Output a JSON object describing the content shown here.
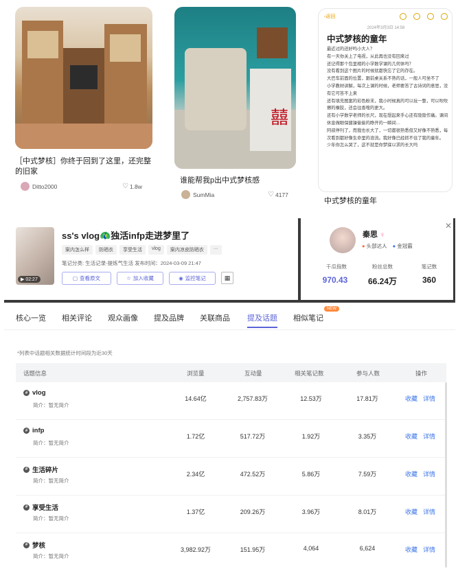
{
  "feed": {
    "card1": {
      "title": "［中式梦核］你终于回到了这里，还完整的旧家",
      "author": "Ditto2000",
      "likes": "1.8w"
    },
    "card2": {
      "title": "谁能帮我p出中式梦核感",
      "author": "SumMia",
      "likes": "4177"
    },
    "card3": {
      "caption": "中式梦核的童年",
      "note": {
        "back_label": "返回",
        "date": "2024年3月3日 14:58",
        "title": "中式梦核的童年",
        "body": "最近过的还好吗小大人？\n有一天你关上了电视，从此再也没有回来过\n还记得那个包里相的小学数学课的几何体吗？\n没有看到这个图片的时候就都快忘了它的存在。\n大巴车前面的位置，跟前桌关系不熟的话，一般人可坐不了\n小学教材讲解，每次上课的时候，老师要答了古诗词的意思，没有它可答不上来\n还有填充图案的彩色粉末，我小时候真的可以玩一整，可以吹吹擦的橡胶，还会往香嗖的更大。\n还有小学数学老师的长尺，现在想起来手心还有隐隐作痛。课间休息做眼保健操偷偷的睁开的一瞬间…\n阿叔停刊了，而我也长大了，一切都很熟悉但又好像不熟悉，每次看到都好像生命里的浪流。我好像已经抓不住了我的童年。\n少年你怎么哭了，这不就是你梦寐以求的长大吗"
      }
    }
  },
  "note_detail": {
    "duration": "02:27",
    "title": "ss's vlog🦚独活infp走进梦里了",
    "tags": [
      "案内怎么样",
      "防晒衣",
      "享受生活",
      "vlog",
      "案内凉皮防晒衣",
      "···"
    ],
    "meta": "笔记分类: 生活记录-提炼气生活  发布时间：2024-03-09 21:47",
    "buttons": {
      "view": "查看原文",
      "collect": "加入收藏",
      "monitor": "监控笔记"
    }
  },
  "profile": {
    "name": "秦思",
    "badge1": "头部达人",
    "badge2": "金冠霸",
    "stats": [
      {
        "label": "千瓜指数",
        "value": "970.43"
      },
      {
        "label": "粉丝总数",
        "value": "66.24万"
      },
      {
        "label": "笔记数",
        "value": "360"
      }
    ],
    "accent": "#5a63d8"
  },
  "tabs": [
    "核心一览",
    "相关评论",
    "观众画像",
    "提及品牌",
    "关联商品",
    "提及话题",
    "相似笔记"
  ],
  "active_tab": "提及话题",
  "new_badge": "NEW",
  "table": {
    "note": "*列表中话题相关数据统计时间段为近30天",
    "headers": [
      "话题信息",
      "浏览量",
      "互动量",
      "相关笔记数",
      "参与人数",
      "操作"
    ],
    "ops": [
      "收藏",
      "详情"
    ],
    "rows": [
      {
        "name": "vlog",
        "desc": "简介：暂无简介",
        "views": "14.64亿",
        "interact": "2,757.83万",
        "notes": "12.53万",
        "people": "17.81万"
      },
      {
        "name": "infp",
        "desc": "简介：暂无简介",
        "views": "1.72亿",
        "interact": "517.72万",
        "notes": "1.92万",
        "people": "3.35万"
      },
      {
        "name": "生活碎片",
        "desc": "简介：暂无简介",
        "views": "2.34亿",
        "interact": "472.52万",
        "notes": "5.86万",
        "people": "7.59万"
      },
      {
        "name": "享受生活",
        "desc": "简介：暂无简介",
        "views": "1.37亿",
        "interact": "209.26万",
        "notes": "3.96万",
        "people": "8.01万"
      },
      {
        "name": "梦核",
        "desc": "简介：暂无简介",
        "views": "3,982.92万",
        "interact": "151.95万",
        "notes": "4,064",
        "people": "6,624"
      }
    ]
  }
}
